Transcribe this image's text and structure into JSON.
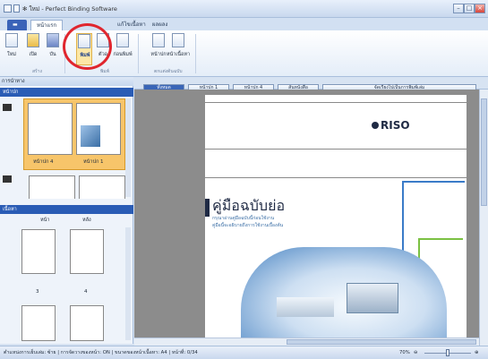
{
  "window": {
    "title": "✻ ใหม่ - Perfect Binding Software"
  },
  "tabs": [
    {
      "label": "หน้าแรก"
    },
    {
      "label": "แก้ไขเนื้อหา"
    },
    {
      "label": "ผลผลง"
    }
  ],
  "ribbon": {
    "buttons": [
      {
        "label": "ใหม่"
      },
      {
        "label": "เปิด"
      },
      {
        "label": "บัน"
      },
      {
        "label": "พิมพ์"
      },
      {
        "label": "ตัวอ"
      },
      {
        "label": "ก่อนพิมพ์"
      },
      {
        "label": "หน้าปก"
      },
      {
        "label": "หน้าเนื้อหา"
      }
    ],
    "groups": [
      "สร้าง",
      "พิมพ์",
      "ตกแต่งต้นฉบับ"
    ]
  },
  "left_pane": {
    "navigator_title": "การนำทาง",
    "cover_section": "หน้าปก",
    "thumb_labels": [
      "หน้าปก 4",
      "หน้าปก 1"
    ],
    "content_section": "เนื้อหา",
    "col_front": "หน้า",
    "col_back": "หลัง",
    "page_numbers": [
      "3",
      "4"
    ]
  },
  "toolbar": {
    "buttons": [
      "ทั้งหมด",
      "หน้าปก 1",
      "หน้าปก 4",
      "สันหนังสือ",
      "จัดเรียงไปเป็นการพิมพ์เล่ม"
    ]
  },
  "document": {
    "brand": "RISO",
    "heading": "คู่มือฉบับย่อ",
    "sub1": "กรุณาอ่านคู่มือฉบับนี้ก่อนใช้งาน",
    "sub2": "คู่มือนี้จะอธิบายถึงการใช้งานเบื้องต้น"
  },
  "status": {
    "text": "ตำแหน่งการเย็บเล่ม: ซ้าย  |  การจัดวางของหน้า: ON  |  ขนาดของหน้าเนื้อหา: A4  |  หน้าที่: 0/34",
    "zoom": "70%"
  }
}
